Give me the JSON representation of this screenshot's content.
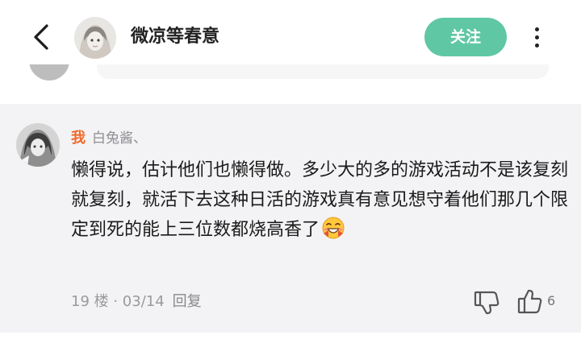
{
  "header": {
    "author_name": "微凉等春意",
    "follow_label": "关注",
    "icons": {
      "back": "chevron-left-icon",
      "more": "more-vertical-icon"
    },
    "colors": {
      "follow_bg": "#5fc7a4",
      "follow_text": "#ffffff"
    }
  },
  "comment": {
    "self_tag": "我",
    "reply_to": "白兔酱、",
    "text": "懒得说，估计他们也懒得做。多少大的多的游戏活动不是该复刻就复刻，就活下去这种日活的游戏真有意见想守着他们那几个限定到死的能上三位数都烧高香了",
    "floor": "19 楼 · 03/14",
    "reply_label": "回复",
    "like_count": "6",
    "icons": {
      "emoji": "grinning-emoji-icon",
      "dislike": "thumbs-down-icon",
      "like": "thumbs-up-icon"
    },
    "colors": {
      "self_tag": "#f06a2b",
      "card_bg": "#f3f3f5"
    }
  }
}
